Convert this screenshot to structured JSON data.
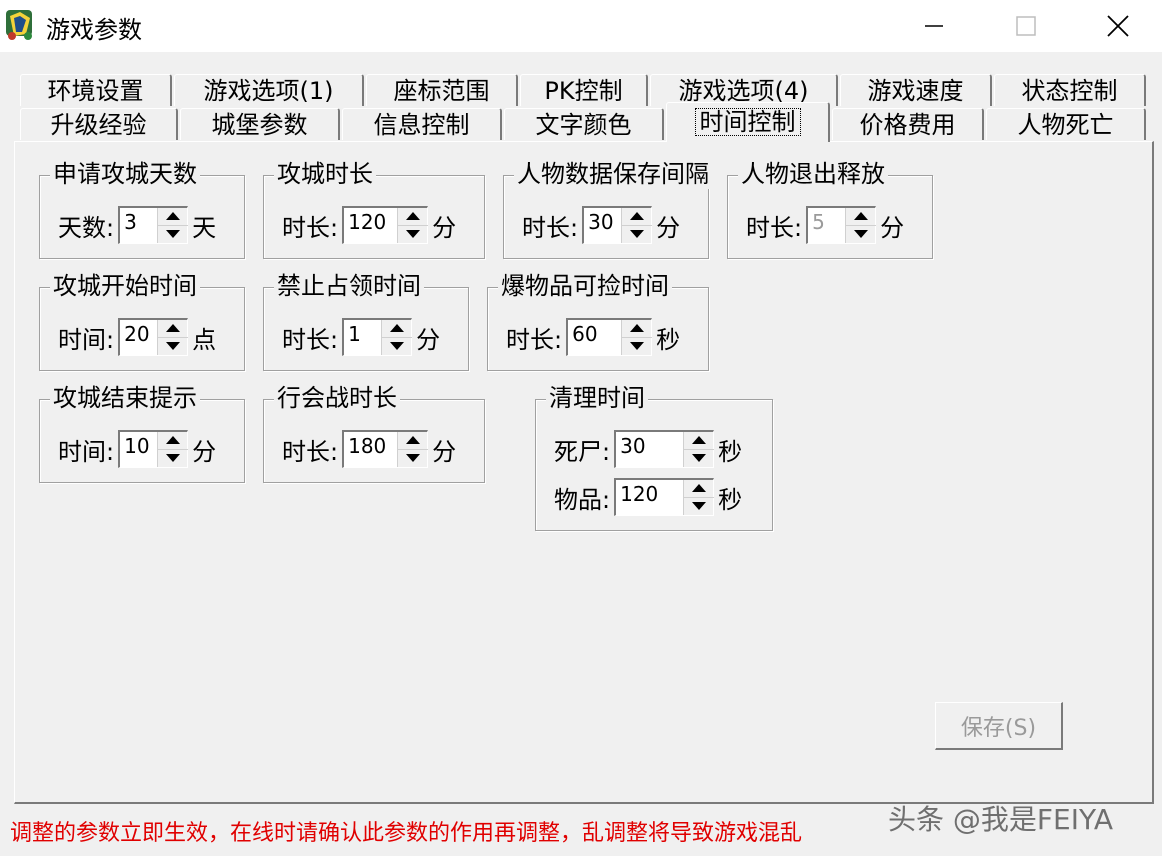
{
  "window": {
    "title": "游戏参数"
  },
  "tabs_row1": [
    "环境设置",
    "游戏选项(1)",
    "座标范围",
    "PK控制",
    "游戏选项(4)",
    "游戏速度",
    "状态控制"
  ],
  "tabs_row2": [
    "升级经验",
    "城堡参数",
    "信息控制",
    "文字颜色",
    "时间控制",
    "价格费用",
    "人物死亡"
  ],
  "active_tab": "时间控制",
  "groups": {
    "siege_apply_days": {
      "title": "申请攻城天数",
      "label": "天数:",
      "value": "3",
      "unit": "天"
    },
    "siege_duration": {
      "title": "攻城时长",
      "label": "时长:",
      "value": "120",
      "unit": "分"
    },
    "save_interval": {
      "title": "人物数据保存间隔",
      "label": "时长:",
      "value": "30",
      "unit": "分"
    },
    "logout_release": {
      "title": "人物退出释放",
      "label": "时长:",
      "value": "5",
      "unit": "分"
    },
    "siege_start": {
      "title": "攻城开始时间",
      "label": "时间:",
      "value": "20",
      "unit": "点"
    },
    "occupy_forbid": {
      "title": "禁止占领时间",
      "label": "时长:",
      "value": "1",
      "unit": "分"
    },
    "drop_pickup": {
      "title": "爆物品可捡时间",
      "label": "时长:",
      "value": "60",
      "unit": "秒"
    },
    "siege_end_notice": {
      "title": "攻城结束提示",
      "label": "时间:",
      "value": "10",
      "unit": "分"
    },
    "guild_war": {
      "title": "行会战时长",
      "label": "时长:",
      "value": "180",
      "unit": "分"
    },
    "cleanup": {
      "title": "清理时间",
      "corpse": {
        "label": "死尸:",
        "value": "30",
        "unit": "秒"
      },
      "items": {
        "label": "物品:",
        "value": "120",
        "unit": "秒"
      }
    }
  },
  "save_button": "保存(S)",
  "warning": "调整的参数立即生效，在线时请确认此参数的作用再调整，乱调整将导致游戏混乱",
  "watermark": "头条 @我是FEIYA",
  "colors": {
    "warning": "#e00000",
    "face": "#f0f0f0",
    "disabled_text": "#9a9a9a"
  }
}
